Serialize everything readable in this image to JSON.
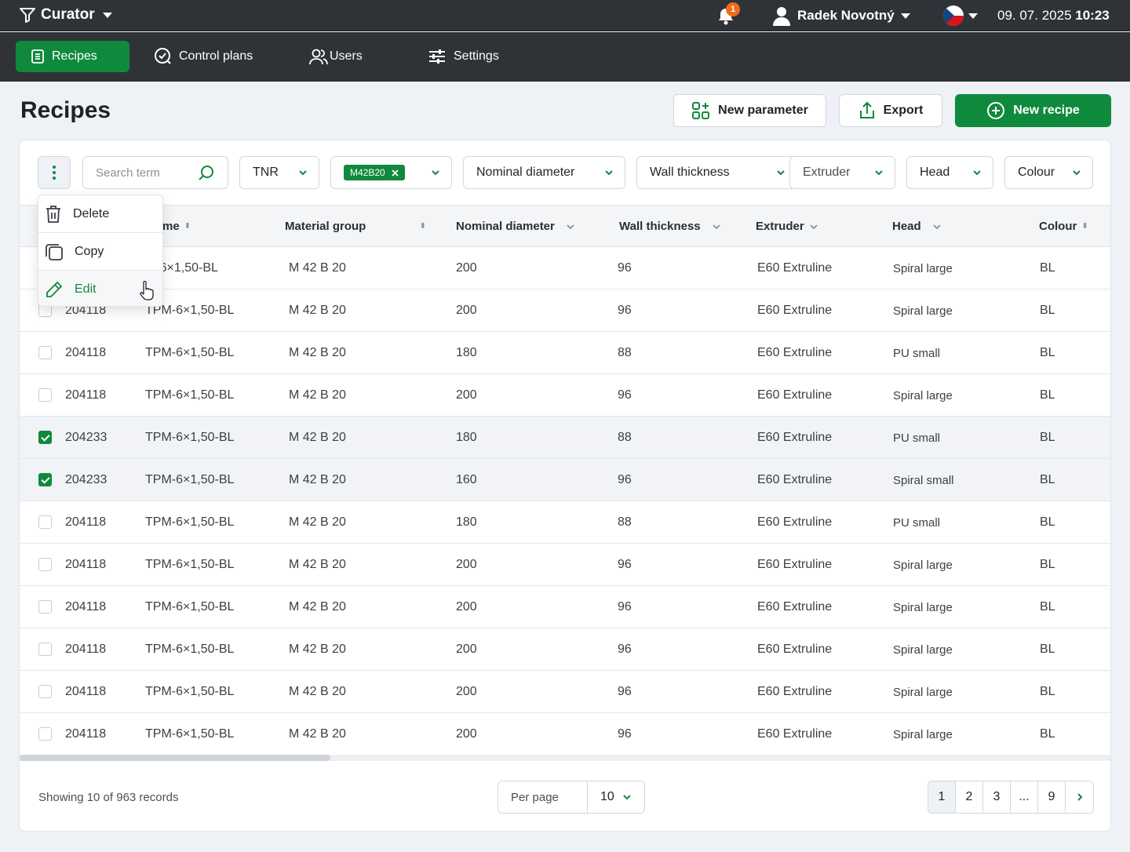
{
  "app": {
    "name": "Curator"
  },
  "topbar": {
    "notification_count": "1",
    "user_name": "Radek Novotný",
    "date": "09. 07. 2025",
    "time": "10:23",
    "language_flag": "cz-flag-icon"
  },
  "nav": {
    "items": [
      {
        "label": "Recipes",
        "icon": "recipes-icon",
        "active": true
      },
      {
        "label": "Control plans",
        "icon": "check-circle-icon",
        "active": false
      },
      {
        "label": "Users",
        "icon": "users-icon",
        "active": false
      },
      {
        "label": "Settings",
        "icon": "sliders-icon",
        "active": false
      }
    ]
  },
  "page": {
    "title": "Recipes",
    "actions": {
      "new_parameter": "New parameter",
      "export": "Export",
      "new_recipe": "New recipe"
    }
  },
  "filters": {
    "search_placeholder": "Search term",
    "tnr": "TNR",
    "chip": "M42B20",
    "nominal_diameter": "Nominal diameter",
    "wall_thickness": "Wall thickness",
    "extruder": "Extruder",
    "head": "Head",
    "colour": "Colour"
  },
  "context_menu": {
    "delete": "Delete",
    "copy": "Copy",
    "edit": "Edit"
  },
  "table": {
    "headers": {
      "name_partial": "me",
      "material_group": "Material group",
      "nominal_diameter": "Nominal diameter",
      "wall_thickness": "Wall thickness",
      "extruder": "Extruder",
      "head": "Head",
      "colour": "Colour"
    },
    "rows": [
      {
        "checked": false,
        "id": "",
        "name": "M-6×1,50-BL",
        "material": "M 42 B 20",
        "diameter": "200",
        "wall": "96",
        "extruder": "E60 Extruline",
        "head": "Spiral large",
        "colour": "BL"
      },
      {
        "checked": false,
        "id": "204118",
        "name": "TPM-6×1,50-BL",
        "material": "M 42 B 20",
        "diameter": "200",
        "wall": "96",
        "extruder": "E60 Extruline",
        "head": "Spiral large",
        "colour": "BL"
      },
      {
        "checked": false,
        "id": "204118",
        "name": "TPM-6×1,50-BL",
        "material": "M 42 B 20",
        "diameter": "180",
        "wall": "88",
        "extruder": "E60 Extruline",
        "head": "PU small",
        "colour": "BL"
      },
      {
        "checked": false,
        "id": "204118",
        "name": "TPM-6×1,50-BL",
        "material": "M 42 B 20",
        "diameter": "200",
        "wall": "96",
        "extruder": "E60 Extruline",
        "head": "Spiral large",
        "colour": "BL"
      },
      {
        "checked": true,
        "id": "204233",
        "name": "TPM-6×1,50-BL",
        "material": "M 42 B 20",
        "diameter": "180",
        "wall": "88",
        "extruder": "E60 Extruline",
        "head": "PU small",
        "colour": "BL"
      },
      {
        "checked": true,
        "id": "204233",
        "name": "TPM-6×1,50-BL",
        "material": "M 42 B 20",
        "diameter": "160",
        "wall": "96",
        "extruder": "E60 Extruline",
        "head": "Spiral small",
        "colour": "BL"
      },
      {
        "checked": false,
        "id": "204118",
        "name": "TPM-6×1,50-BL",
        "material": "M 42 B 20",
        "diameter": "180",
        "wall": "88",
        "extruder": "E60 Extruline",
        "head": "PU small",
        "colour": "BL"
      },
      {
        "checked": false,
        "id": "204118",
        "name": "TPM-6×1,50-BL",
        "material": "M 42 B 20",
        "diameter": "200",
        "wall": "96",
        "extruder": "E60 Extruline",
        "head": "Spiral large",
        "colour": "BL"
      },
      {
        "checked": false,
        "id": "204118",
        "name": "TPM-6×1,50-BL",
        "material": "M 42 B 20",
        "diameter": "200",
        "wall": "96",
        "extruder": "E60 Extruline",
        "head": "Spiral large",
        "colour": "BL"
      },
      {
        "checked": false,
        "id": "204118",
        "name": "TPM-6×1,50-BL",
        "material": "M 42 B 20",
        "diameter": "200",
        "wall": "96",
        "extruder": "E60 Extruline",
        "head": "Spiral large",
        "colour": "BL"
      },
      {
        "checked": false,
        "id": "204118",
        "name": "TPM-6×1,50-BL",
        "material": "M 42 B 20",
        "diameter": "200",
        "wall": "96",
        "extruder": "E60 Extruline",
        "head": "Spiral large",
        "colour": "BL"
      },
      {
        "checked": false,
        "id": "204118",
        "name": "TPM-6×1,50-BL",
        "material": "M 42 B 20",
        "diameter": "200",
        "wall": "96",
        "extruder": "E60 Extruline",
        "head": "Spiral large",
        "colour": "BL"
      }
    ]
  },
  "footer": {
    "showing": "Showing 10 of 963 records",
    "per_page_label": "Per page",
    "per_page_value": "10",
    "pages": [
      "1",
      "2",
      "3",
      "...",
      "9"
    ],
    "current_page": "1"
  },
  "colors": {
    "brand_green": "#0f8a3c",
    "topbar_bg": "#2f3338",
    "badge_orange": "#f26b1d"
  }
}
